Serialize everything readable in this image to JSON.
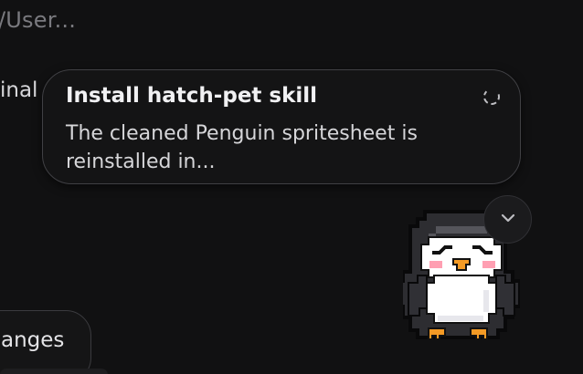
{
  "background": {
    "path_fragment": "/User...",
    "terminal_fragment": "inal"
  },
  "notification": {
    "title": "Install hatch-pet skill",
    "body": "The cleaned Penguin spritesheet is reinstalled in...",
    "status_icon": "loading-spinner-icon"
  },
  "expand_button": {
    "icon": "chevron-down-icon"
  },
  "pet": {
    "name": "Penguin",
    "icon": "penguin-pet-icon"
  },
  "changes_tab": {
    "label": "anges"
  },
  "colors": {
    "background": "#111112",
    "card": "#141415",
    "card_border": "#404044",
    "text_primary": "#f1f1f3",
    "text_muted": "#7a7a7f",
    "beak": "#f39a25",
    "cheeks": "#ff9fb2"
  }
}
